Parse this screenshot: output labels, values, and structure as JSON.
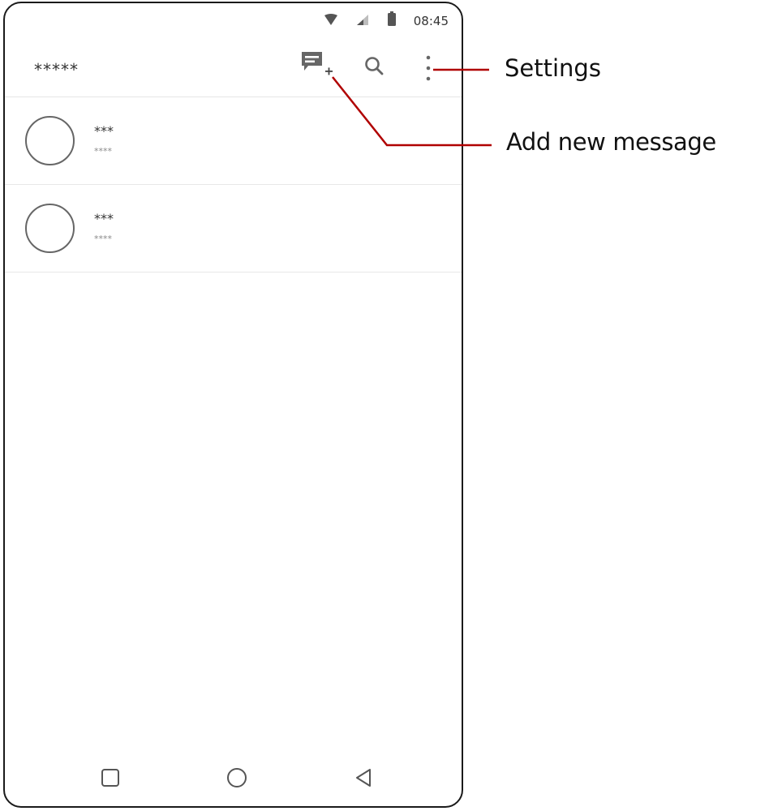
{
  "status_bar": {
    "time": "08:45",
    "icons": [
      "wifi-icon",
      "signal-icon",
      "battery-icon"
    ]
  },
  "app_bar": {
    "title": "*****",
    "actions": [
      "new-message-icon",
      "search-icon",
      "overflow-menu-icon"
    ]
  },
  "conversations": [
    {
      "name": "***",
      "preview": "****"
    },
    {
      "name": "***",
      "preview": "****"
    }
  ],
  "nav_bar": {
    "buttons": [
      "recents-square-icon",
      "home-circle-icon",
      "back-triangle-icon"
    ]
  },
  "callouts": {
    "settings": "Settings",
    "add_new_message": "Add new message"
  },
  "colors": {
    "callout_line": "#b00000",
    "icon_gray": "#666666",
    "text_dark": "#333333",
    "text_muted": "#8a8a8a"
  }
}
